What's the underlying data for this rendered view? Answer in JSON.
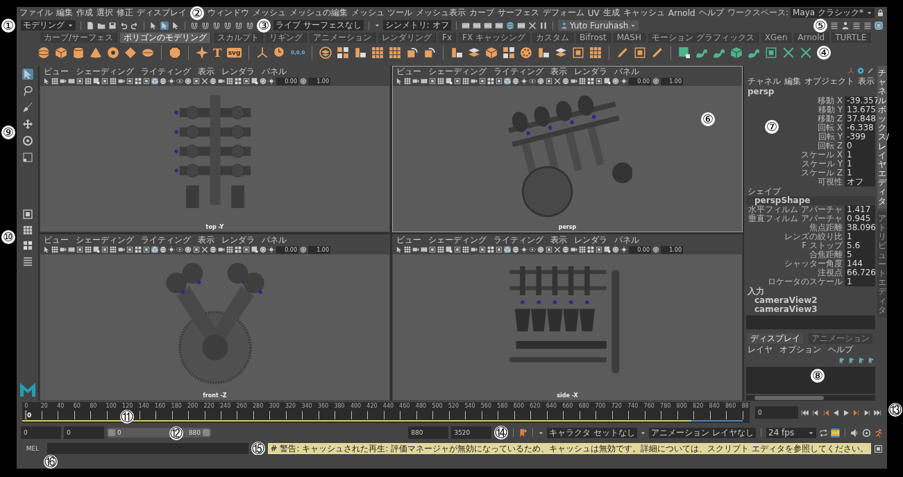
{
  "menu_bar": {
    "items": [
      "ファイル",
      "編集",
      "作成",
      "選択",
      "修正",
      "ディスプレイ",
      "ウィンドウ",
      "メッシュ",
      "メッシュの編集",
      "メッシュ ツール",
      "メッシュ表示",
      "カーブ",
      "サーフェス",
      "デフォーム",
      "UV",
      "生成",
      "キャッシュ",
      "Arnold",
      "ヘルプ"
    ],
    "workspace_label": "ワークスペース:",
    "workspace": "Maya クラシック*"
  },
  "status_line": {
    "mode": "モデリング",
    "live_surface": "ライブ サーフェスなし",
    "symmetry": "シンメトリ: オフ",
    "user": "Yuto Furuhash"
  },
  "shelf": {
    "tabs": [
      {
        "label": "カーブ/サーフェス",
        "selected": false
      },
      {
        "label": "ポリゴンのモデリング",
        "selected": true
      },
      {
        "label": "スカルプト",
        "selected": false
      },
      {
        "label": "リギング",
        "selected": false
      },
      {
        "label": "アニメーション",
        "selected": false
      },
      {
        "label": "レンダリング",
        "selected": false
      },
      {
        "label": "Fx",
        "selected": false
      },
      {
        "label": "FX キャッシング",
        "selected": false
      },
      {
        "label": "カスタム",
        "selected": false
      },
      {
        "label": "Bifrost",
        "selected": false
      },
      {
        "label": "MASH",
        "selected": false
      },
      {
        "label": "モーション グラフィックス",
        "selected": false
      },
      {
        "label": "XGen",
        "selected": false
      },
      {
        "label": "Arnold",
        "selected": false
      },
      {
        "label": "TURTLE",
        "selected": false
      }
    ],
    "icon_labels": [
      "T",
      "svg",
      "0,0,0"
    ]
  },
  "viewports": [
    {
      "kind": "top",
      "menu": [
        "ビュー",
        "シェーディング",
        "ライティング",
        "表示",
        "レンダラ",
        "パネル"
      ],
      "near": "0.00",
      "far": "1.00",
      "camera": "top -Y",
      "active": false
    },
    {
      "kind": "persp",
      "menu": [
        "ビュー",
        "シェーディング",
        "ライティング",
        "表示",
        "レンダラ",
        "パネル"
      ],
      "near": "0.00",
      "far": "1.00",
      "camera": "persp",
      "active": true
    },
    {
      "kind": "front",
      "menu": [
        "ビュー",
        "シェーディング",
        "ライティング",
        "表示",
        "レンダラ",
        "パネル"
      ],
      "near": "0.00",
      "far": "1.00",
      "camera": "front -Z",
      "active": false
    },
    {
      "kind": "side",
      "menu": [
        "ビュー",
        "シェーディング",
        "ライティング",
        "表示",
        "レンダラ",
        "パネル"
      ],
      "near": "0.00",
      "far": "1.00",
      "camera": "side -X",
      "active": false
    }
  ],
  "channel_box": {
    "menu": [
      "チャネル",
      "編集",
      "オブジェクト",
      "表示"
    ],
    "object": "persp",
    "attributes": [
      {
        "label": "移動 X",
        "value": "-39.357"
      },
      {
        "label": "移動 Y",
        "value": "13.675"
      },
      {
        "label": "移動 Z",
        "value": "37.848"
      },
      {
        "label": "回転 X",
        "value": "-6.338"
      },
      {
        "label": "回転 Y",
        "value": "-399"
      },
      {
        "label": "回転 Z",
        "value": "0"
      },
      {
        "label": "スケール X",
        "value": "1"
      },
      {
        "label": "スケール Y",
        "value": "1"
      },
      {
        "label": "スケール Z",
        "value": "1"
      },
      {
        "label": "可視性",
        "value": "オフ"
      }
    ],
    "shape_heading": "シェイプ",
    "shape": "perspShape",
    "shape_attributes": [
      {
        "label": "水平フィルム アパーチャ",
        "value": "1.417"
      },
      {
        "label": "垂直フィルム アパーチャ",
        "value": "0.945"
      },
      {
        "label": "焦点距離",
        "value": "38.096"
      },
      {
        "label": "レンズの絞り比",
        "value": "1"
      },
      {
        "label": "F ストップ",
        "value": "5.6"
      },
      {
        "label": "合焦距離",
        "value": "5"
      },
      {
        "label": "シャッター角度",
        "value": "144"
      },
      {
        "label": "注視点",
        "value": "66.726"
      },
      {
        "label": "ロケータのスケール",
        "value": "1"
      }
    ],
    "inputs_heading": "入力",
    "inputs": [
      "cameraView2",
      "cameraView3"
    ]
  },
  "layer_editor": {
    "tabs": [
      {
        "label": "ディスプレイ",
        "selected": true
      },
      {
        "label": "アニメーション",
        "selected": false
      }
    ],
    "menu": [
      "レイヤ",
      "オプション",
      "ヘルプ"
    ]
  },
  "side_tabs": [
    {
      "label": "チャネルボックス/レイヤエディタ",
      "selected": true
    },
    {
      "label": "アトリビュートエディタ",
      "selected": false
    }
  ],
  "time_slider": {
    "ticks": [
      "0",
      "20",
      "40",
      "60",
      "80",
      "100",
      "120",
      "140",
      "160",
      "180",
      "200",
      "220",
      "240",
      "260",
      "280",
      "300",
      "320",
      "340",
      "360",
      "380",
      "400",
      "420",
      "440",
      "460",
      "480",
      "500",
      "520",
      "540",
      "560",
      "580",
      "600",
      "620",
      "640",
      "660",
      "680",
      "700",
      "720",
      "740",
      "760",
      "780",
      "800",
      "820",
      "840",
      "860",
      "88"
    ],
    "current": "0",
    "level": 0,
    "frame_field": "0"
  },
  "range_slider": {
    "start": "0",
    "range_start": "0",
    "handle_start": "0",
    "handle_end": "880",
    "level": 1,
    "range_end": "880",
    "end": "3520",
    "character_set": "キャラクタ セットなし",
    "anim_layer": "アニメーション レイヤなし",
    "fps": "24 fps"
  },
  "command_line": {
    "language": "MEL",
    "message": "# 警告: キャッシュされた再生: 評価マネージャが無効になっているため、キャッシュは無効です。詳細については、スクリプト エディタを参照してください。"
  },
  "callouts": [
    "①",
    "②",
    "③",
    "④",
    "⑤",
    "⑥",
    "⑦",
    "⑧",
    "⑨",
    "⑩",
    "⑪",
    "⑫",
    "⑬",
    "⑭",
    "⑮",
    "⑯"
  ]
}
